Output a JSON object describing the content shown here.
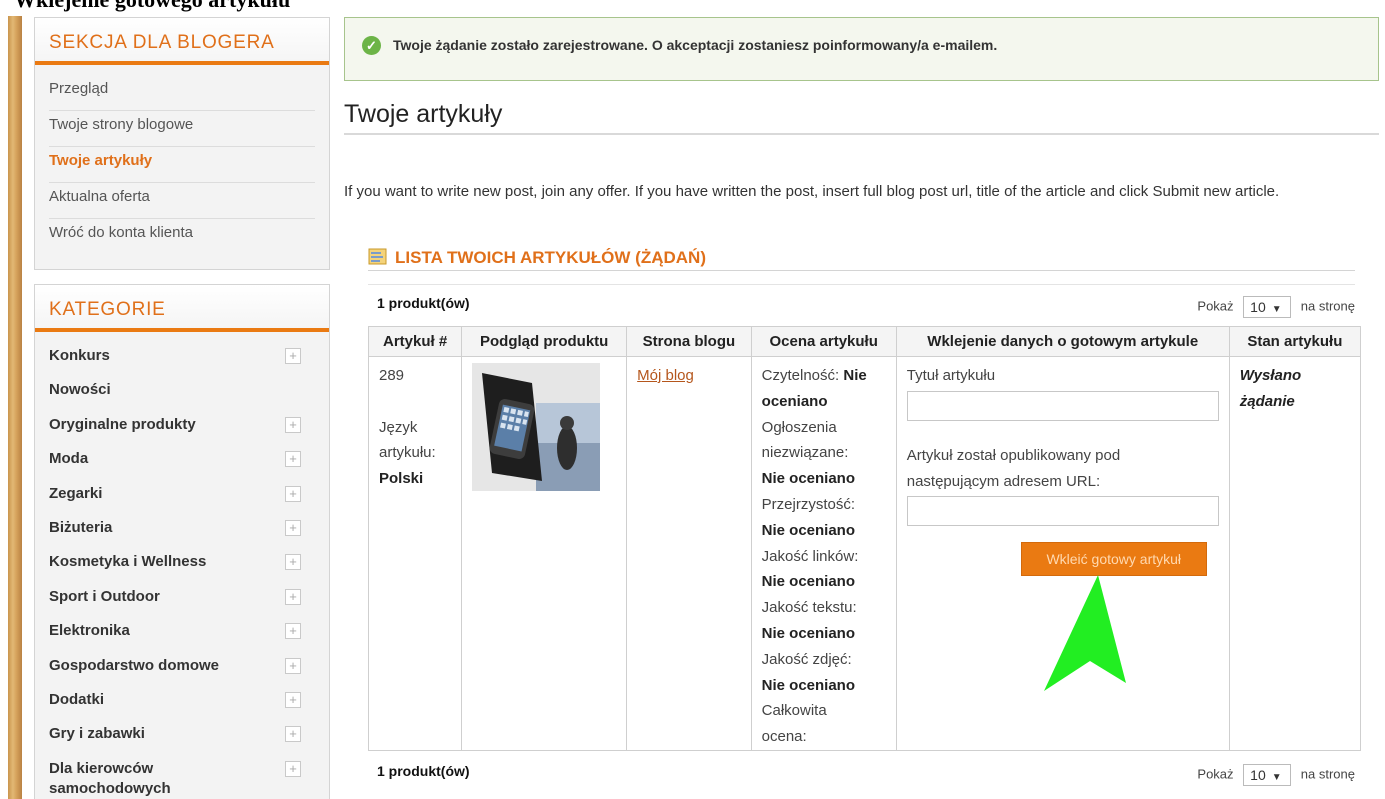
{
  "doc_heading": "Wklejenie gotowego artykułu",
  "sidebar": {
    "blogger_section": {
      "title": "SEKCJA DLA BLOGERA",
      "items": [
        {
          "label": "Przegląd",
          "active": false
        },
        {
          "label": "Twoje strony blogowe",
          "active": false
        },
        {
          "label": "Twoje artykuły",
          "active": true
        },
        {
          "label": "Aktualna oferta",
          "active": false
        },
        {
          "label": "Wróć do konta klienta",
          "active": false
        }
      ]
    },
    "categories": {
      "title": "KATEGORIE",
      "items": [
        {
          "label": "Konkurs",
          "expandable": true
        },
        {
          "label": "Nowości",
          "expandable": false
        },
        {
          "label": "Oryginalne produkty",
          "expandable": true
        },
        {
          "label": "Moda",
          "expandable": true
        },
        {
          "label": "Zegarki",
          "expandable": true
        },
        {
          "label": "Biżuteria",
          "expandable": true
        },
        {
          "label": "Kosmetyka i Wellness",
          "expandable": true
        },
        {
          "label": "Sport i Outdoor",
          "expandable": true
        },
        {
          "label": "Elektronika",
          "expandable": true
        },
        {
          "label": "Gospodarstwo domowe",
          "expandable": true
        },
        {
          "label": "Dodatki",
          "expandable": true
        },
        {
          "label": "Gry i zabawki",
          "expandable": true
        },
        {
          "label": "Dla kierowców samochodowych",
          "expandable": true
        }
      ],
      "expand_symbol": "+"
    }
  },
  "notice": {
    "text": "Twoje żądanie zostało zarejestrowane. O akceptacji zostaniesz poinformowany/a e-mailem."
  },
  "page": {
    "title": "Twoje artykuły",
    "intro": "If you want to write new post, join any offer. If you have written the post, insert full blog post url, title of the article and click Submit new article."
  },
  "list": {
    "title": "LISTA TWOICH ARTYKUŁÓW (ŻĄDAŃ)",
    "count_label": "1 produkt(ów)",
    "show_label": "Pokaż",
    "per_page": "10",
    "per_page_suffix": "na stronę",
    "columns": [
      "Artykuł #",
      "Podgląd produktu",
      "Strona blogu",
      "Ocena artykułu",
      "Wklejenie danych o gotowym artykule",
      "Stan artykułu"
    ],
    "rows": [
      {
        "id": "289",
        "language_label": "Język artykułu:",
        "language": "Polski",
        "blog_link": "Mój blog",
        "ratings": [
          {
            "label": "Czytelność:",
            "value": "Nie oceniano"
          },
          {
            "label": "Ogłoszenia niezwiązane:",
            "value": "Nie oceniano"
          },
          {
            "label": "Przejrzystość:",
            "value": "Nie oceniano"
          },
          {
            "label": "Jakość linków:",
            "value": "Nie oceniano"
          },
          {
            "label": "Jakość tekstu:",
            "value": "Nie oceniano"
          },
          {
            "label": "Jakość zdjęć:",
            "value": "Nie oceniano"
          },
          {
            "label": "Całkowita ocena:",
            "value": ""
          }
        ],
        "title_label": "Tytuł artykułu",
        "title_value": "",
        "url_label": "Artykuł został opublikowany pod następującym adresem URL:",
        "url_value": "",
        "submit_label": "Wkleić gotowy artykuł",
        "status": "Wysłano żądanie"
      }
    ]
  },
  "colors": {
    "accent": "#ea7a12",
    "notice_border": "#a7c48c",
    "arrow": "#22ee22"
  },
  "icons": [
    "check-circle-icon",
    "list-icon",
    "plus-icon",
    "dropdown-arrow-icon",
    "green-arrow-pointer"
  ]
}
